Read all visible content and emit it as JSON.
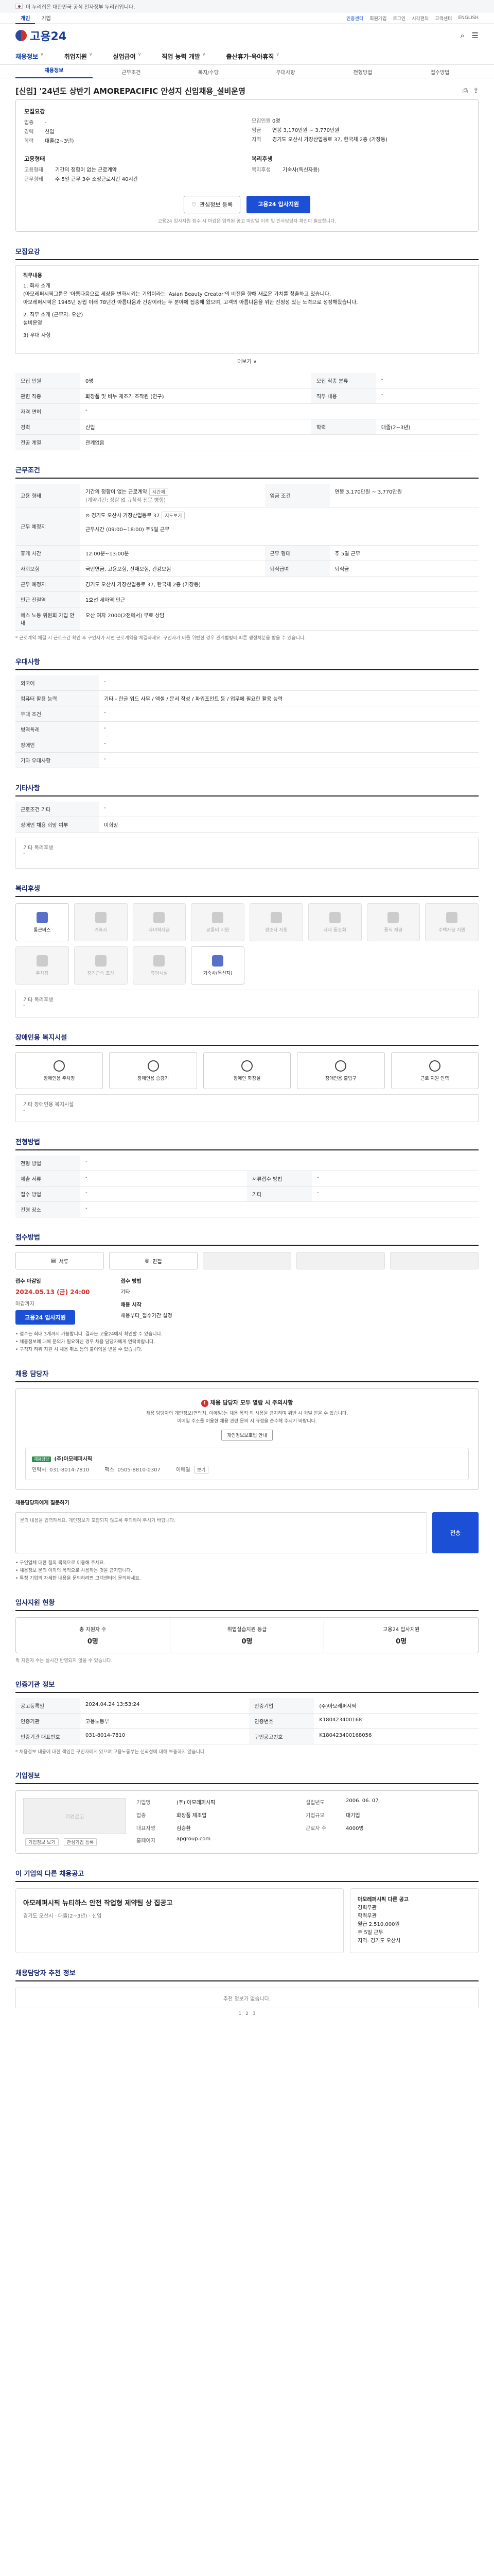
{
  "gov_bar": {
    "text": "이 누리집은 대한민국 공식 전자정부 누리집입니다."
  },
  "topnav": {
    "tabs": [
      "개인",
      "기업"
    ],
    "right": [
      "인증센터",
      "회원가입",
      "로그인",
      "시각편의",
      "고객센터",
      "ENGLISH"
    ]
  },
  "header": {
    "logo": "고용24"
  },
  "gnb": {
    "items": [
      "채용정보",
      "취업지원",
      "실업급여",
      "직업 능력 개발",
      "출산휴가·육아휴직"
    ]
  },
  "subnav": {
    "items": [
      "채용정보",
      "근무조건",
      "복지/수당",
      "우대사항",
      "전형방법",
      "접수방법"
    ]
  },
  "job": {
    "title": "[신입] '24년도 상반기 AMOREPACIFIC 안성지 신입채용_설비운영",
    "company_h": "모집요강",
    "kv1": [
      [
        "업종",
        "-"
      ],
      [
        "경력",
        "신입"
      ],
      [
        "학력",
        "대졸(2~3년)"
      ]
    ],
    "kv2": [
      [
        "모집인원",
        "0명"
      ],
      [
        "임금",
        "연봉 3,170만원 ~ 3,770만원"
      ],
      [
        "지역",
        "경기도 오산시 가장산업동로 37, 한국체 2층 (가장동)"
      ]
    ],
    "employ_h": "고용형태",
    "employ": [
      [
        "고용형태",
        "기간의 정함이 없는 근로계약"
      ],
      [
        "근무형태",
        "주 5일 근무 3주 소정근로시간 40시간"
      ]
    ],
    "welfare_h": "복리후생",
    "welfare": [
      [
        "복리후생",
        "기숙사(독신자용)"
      ]
    ],
    "save_label": "관심정보 등록",
    "apply_label": "고용24 입사지원",
    "notice": "고용24 입사지원 접수 시 마감은 입력된 공고 마감일 이후 및 인사담당자 확인이 필요합니다."
  },
  "sections": {
    "recruit": "모집요강",
    "cond": "근무조건",
    "pref": "우대사항",
    "etc": "기타사항",
    "benefit": "복리후생",
    "disabled": "장애인용 복지시설",
    "selection": "전형방법",
    "method": "접수방법",
    "manager": "채용 담당자",
    "status": "입사지원 현황",
    "info": "인증기관 정보",
    "corp": "기업정보",
    "others": "이 기업의 다른 채용공고",
    "reco": "채용담당자 추천 정보"
  },
  "desc": {
    "head": "직무내용",
    "lines": [
      "1. 회사 소개",
      "(아모레퍼시픽그룹은 '아름다움으로 세상을 변화시키는 기업이라는 'Asian Beauty Creator'의 비전을 향해 새로운 가치를 창출하고 있습니다.",
      "아모레퍼시픽은 1945년 창립 이래 78년간 아름다움과 건강이라는 두 분야에 집중해 왔으며, 고객의 아름다움을 위한 진정성 있는 노력으로 성장해왔습니다.",
      "2. 직무 소개 (근무지: 오산)",
      "설비운영",
      "3) 우대 사항"
    ],
    "more": "더보기"
  },
  "recruit_table": [
    [
      "모집 인원",
      "0명",
      "모집 직종 분류",
      "-"
    ],
    [
      "관련 직종",
      "화장품 및 비누 제조기 조작원 (연구)",
      "직무 내용",
      "-"
    ],
    [
      "자격 면허",
      "-",
      "",
      ""
    ],
    [
      "경력",
      "신입",
      "학력",
      "대졸(2~3년)"
    ],
    [
      "전공 계열",
      "관계없음",
      "",
      ""
    ]
  ],
  "cond_table": {
    "employ_type": "기간의 정함이 없는 근로계약",
    "employ_chip": "시간제",
    "employ_sub": "(계약기간: 정함 없 규칙적 전문 병행)",
    "wage": "연봉 3,170만원 ~ 3,770만원",
    "wage_label": "임금 조건",
    "region_label": "근무 예정지",
    "region": "경기도 오산시 가장산업동로 37",
    "region_map": "지도보기",
    "hours": "근무시간 (09:00~18:00) 주5일 근무",
    "rows": [
      [
        "휴게 시간",
        "12:00분~13:00분",
        "근무 형태",
        "주 5일 근무"
      ],
      [
        "사회보험",
        "국민연금, 고용보험, 산재보험, 건강보험",
        "퇴직급여",
        "퇴직금"
      ],
      [
        "근무 예정지",
        "경기도 오산시 가장산업동로 37, 한국체 2층 (가장동)",
        "",
        ""
      ],
      [
        "인근 전철역",
        "1호선 세마역 인근",
        "",
        ""
      ],
      [
        "혜스 노동 위원회 가입 안내",
        "오산 여자 2000(2천에서) 무료 상담",
        "",
        ""
      ]
    ],
    "notes": "* 근로계약 체결 시 근로조건 확인 후 구인자가 서면 근로계약을 체결하세요. 구인자가 이를 위반한 경우 관계법령에 따른 행정처분을 받을 수 있습니다."
  },
  "pref_table": [
    [
      "외국어",
      "-"
    ],
    [
      "컴퓨터 활용 능력",
      "기타 - 한글 워드 사무 / 엑셀 / 문서 작성 / 파워포인트 등 / 업무에 필요한 활용 능력"
    ],
    [
      "우대 조건",
      "-"
    ],
    [
      "병역특례",
      "-"
    ],
    [
      "장애인",
      "-"
    ],
    [
      "기타 우대사항",
      "-"
    ]
  ],
  "etc_table": [
    [
      "근로조건 기타",
      "-"
    ],
    [
      "장애인 채용 희망 여부",
      "미희망"
    ]
  ],
  "etc_box": {
    "label": "기타 복리후생",
    "text": "-"
  },
  "benefits": [
    {
      "label": "통근버스",
      "on": true
    },
    {
      "label": "기숙사",
      "on": false
    },
    {
      "label": "자녀학자금",
      "on": false
    },
    {
      "label": "교통비 지원",
      "on": false
    },
    {
      "label": "경조사 지원",
      "on": false
    },
    {
      "label": "사내 동호회",
      "on": false
    },
    {
      "label": "중식 제공",
      "on": false
    },
    {
      "label": "주택자금 지원",
      "on": false
    },
    {
      "label": "주차장",
      "on": false
    },
    {
      "label": "장기근속 포상",
      "on": false
    },
    {
      "label": "휴양시설",
      "on": false
    },
    {
      "label": "기숙사(독신자)",
      "on": true
    }
  ],
  "benefit_other": {
    "label": "기타 복리후생",
    "text": "-"
  },
  "disabled_items": [
    "장애인용 주차장",
    "장애인용 승강기",
    "장애인 화장실",
    "장애인용 출입구",
    "근로 지원 인력"
  ],
  "disabled_other": {
    "label": "기타 장애인용 복지시설",
    "text": "-"
  },
  "selection_table": [
    [
      "전형 방법",
      "-"
    ],
    [
      "제출 서류",
      "-",
      "서류접수 방법",
      "-"
    ],
    [
      "접수 방법",
      "-",
      "기타",
      "-"
    ],
    [
      "전형 장소",
      "-",
      "",
      ""
    ]
  ],
  "method_nav": [
    "서류",
    "면접",
    "",
    "",
    ""
  ],
  "apply": {
    "h1": "접수 마감일",
    "date": "2024.05.13 (금) 24:00",
    "dday_label": "마감까지",
    "apply_btn": "고용24 입사지원",
    "h2": "접수 방법",
    "way": "기타",
    "h3": "채용 시작",
    "start": "채용부터_접수기간 설정"
  },
  "apply_notes": [
    "접수는 최대 3개까지 가능합니다. 결과는 고용24에서 확인할 수 있습니다.",
    "채용정보에 대해 문의가 필요하신 경우 채용 담당자에게 연락바랍니다.",
    "구직자 허위 지원 시 채용 취소 등의 불이익을 받을 수 있습니다."
  ],
  "manager": {
    "warn": "채용 담당자 모두 열람 시 주의사항",
    "p1": "채용 담당자의 개인정보(연락처, 이메일)는 채용 목적 외 사용을 금지하며 위반 시 처벌 받을 수 있습니다.",
    "p2": "이메일 주소를 이용한 채용 관련 문의 시 규정을 준수해 주시기 바랍니다.",
    "btn": "개인정보보호법 안내",
    "company_badge": "채용담당",
    "company": "(주)아모레퍼시픽",
    "contact_label": "연락처",
    "contact": "031-8014-7810",
    "fax_label": "팩스",
    "fax": "0505-8810-0307",
    "email_label": "이메일",
    "email": "보기"
  },
  "qa": {
    "label": "채용담당자에게 질문하기",
    "placeholder": "문의 내용을 입력하세요. 개인정보가 포함되지 않도록 주의하여 주시기 바랍니다.",
    "send": "전송",
    "notes": [
      "구인업체 대한 질의 목적으로 이용해 주세요.",
      "채용정보 문의 이외의 목적으로 사용하는 것을 금지합니다.",
      "특정 기업의 자세한 내용을 문의하려면 고객센터에 문의하세요."
    ]
  },
  "status": [
    {
      "label": "총 지원자 수",
      "n": "0명"
    },
    {
      "label": "취업실습지원 등급",
      "n": "0명"
    },
    {
      "label": "고용24 입사지원",
      "n": "0명"
    }
  ],
  "status_note": "위 지원자 수는 실시간 반영되지 않을 수 있습니다.",
  "info_table": [
    [
      "공고등록일",
      "2024.04.24 13:53:24",
      "인증기업",
      "(주)아모레퍼시픽"
    ],
    [
      "인증기관",
      "고용노동부",
      "인증번호",
      "K180423400168"
    ],
    [
      "인증기관 대표번호",
      "031-8014-7810",
      "구인공고번호",
      "K180423400168056"
    ]
  ],
  "info_notes": "* 채용정보 내용에 대한 책임은 구인자에게 있으며 고용노동부는 신뢰성에 대해 보증하지 않습니다.",
  "corp": {
    "logo_alt": "기업로고",
    "fields": [
      [
        "기업명",
        "(주) 아모레퍼시픽",
        "설립년도",
        "2006. 06. 07"
      ],
      [
        "업종",
        "화장품 제조업",
        "기업규모",
        "대기업"
      ],
      [
        "대표자명",
        "김승환",
        "근로자 수",
        "4000명"
      ],
      [
        "홈페이지",
        "apgroup.com",
        "",
        ""
      ]
    ],
    "btn1": "기업정보 보기",
    "btn2": "관심기업 등록"
  },
  "others": {
    "title": "아모레퍼시픽 뉴티하스 안전 작업형 제약팀 상 집공고",
    "meta": "경기도 오산시 · 대졸(2~3년) · 신입",
    "side": [
      "경력무관",
      "학력무관",
      "월급 2,510,000원",
      "주 5일 근무",
      "지역: 경기도 오산시"
    ],
    "side_h": "아모레퍼시픽 다른 공고"
  },
  "reco": {
    "empty": "추천 정보가 없습니다.",
    "pages": [
      "1",
      "2",
      "3"
    ]
  }
}
